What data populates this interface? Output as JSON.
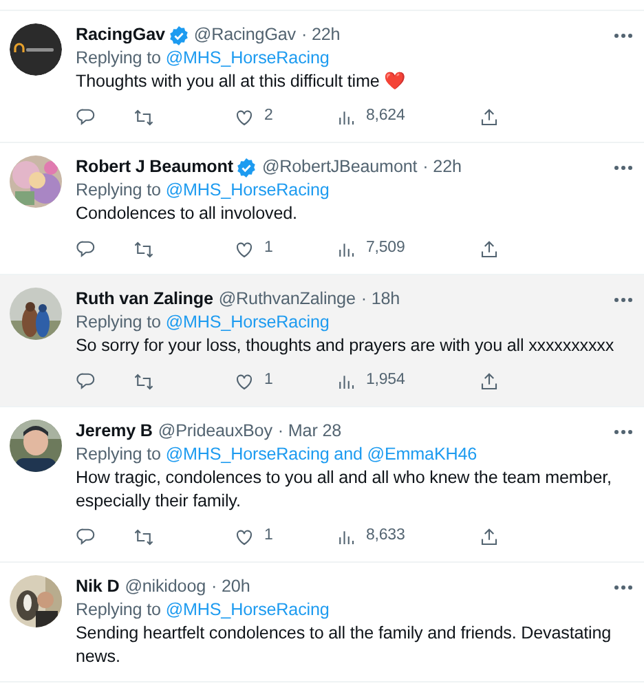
{
  "replies": [
    {
      "avatar": {
        "kind": "logo"
      },
      "name": "RacingGav",
      "verified": true,
      "handle": "@RacingGav",
      "time": "· 22h",
      "replying_label": "Replying to",
      "replying_to": "@MHS_HorseRacing",
      "text": "Thoughts with you all at this difficult time ❤️",
      "highlighted": false,
      "actions": {
        "likes": "2",
        "views": "8,624"
      }
    },
    {
      "name": "Robert J Beaumont",
      "verified": true,
      "handle": "@RobertJBeaumont",
      "time": "· 22h",
      "replying_label": "Replying to",
      "replying_to": "@MHS_HorseRacing",
      "text": "Condolences to all involoved.",
      "highlighted": false,
      "actions": {
        "likes": "1",
        "views": "7,509"
      }
    },
    {
      "name": "Ruth van Zalinge",
      "verified": false,
      "handle": "@RuthvanZalinge",
      "time": "· 18h",
      "replying_label": "Replying to",
      "replying_to": "@MHS_HorseRacing",
      "text": "So sorry for your loss, thoughts and prayers are with you all xxxxxxxxxx",
      "highlighted": true,
      "actions": {
        "likes": "1",
        "views": "1,954"
      }
    },
    {
      "name": "Jeremy B",
      "verified": false,
      "handle": "@PrideauxBoy",
      "time": "· Mar 28",
      "replying_label": "Replying to",
      "replying_to": "@MHS_HorseRacing and @EmmaKH46",
      "text": "How tragic, condolences to you all and all who knew the team member, especially their family.",
      "highlighted": false,
      "actions": {
        "likes": "1",
        "views": "8,633"
      }
    },
    {
      "name": "Nik D",
      "verified": false,
      "handle": "@nikidoog",
      "time": "· 20h",
      "replying_label": "Replying to",
      "replying_to": "@MHS_HorseRacing",
      "text": "Sending heartfelt condolences to all the family and friends. Devastating news.",
      "highlighted": false
    }
  ]
}
